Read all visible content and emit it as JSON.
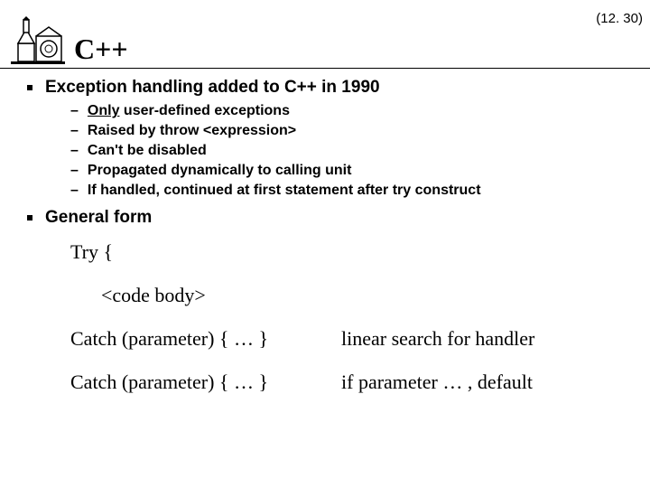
{
  "page_number": "(12. 30)",
  "title": "C++",
  "bullets": [
    {
      "text": "Exception handling added to C++ in 1990",
      "sub": [
        {
          "prefix_underline": "Only",
          "rest": " user-defined exceptions"
        },
        {
          "prefix_underline": "",
          "rest": "Raised by throw <expression>"
        },
        {
          "prefix_underline": "",
          "rest": "Can't be disabled"
        },
        {
          "prefix_underline": "",
          "rest": "Propagated dynamically to calling unit"
        },
        {
          "prefix_underline": "",
          "rest": "If handled, continued at first statement after try construct"
        }
      ]
    },
    {
      "text": "General form",
      "sub": []
    }
  ],
  "code": {
    "line1": "Try {",
    "line2": "<code body>",
    "rows": [
      {
        "left": "Catch (parameter) { … }",
        "right": "linear search for handler"
      },
      {
        "left": "Catch (parameter) { … }",
        "right": "if parameter … , default"
      }
    ]
  }
}
